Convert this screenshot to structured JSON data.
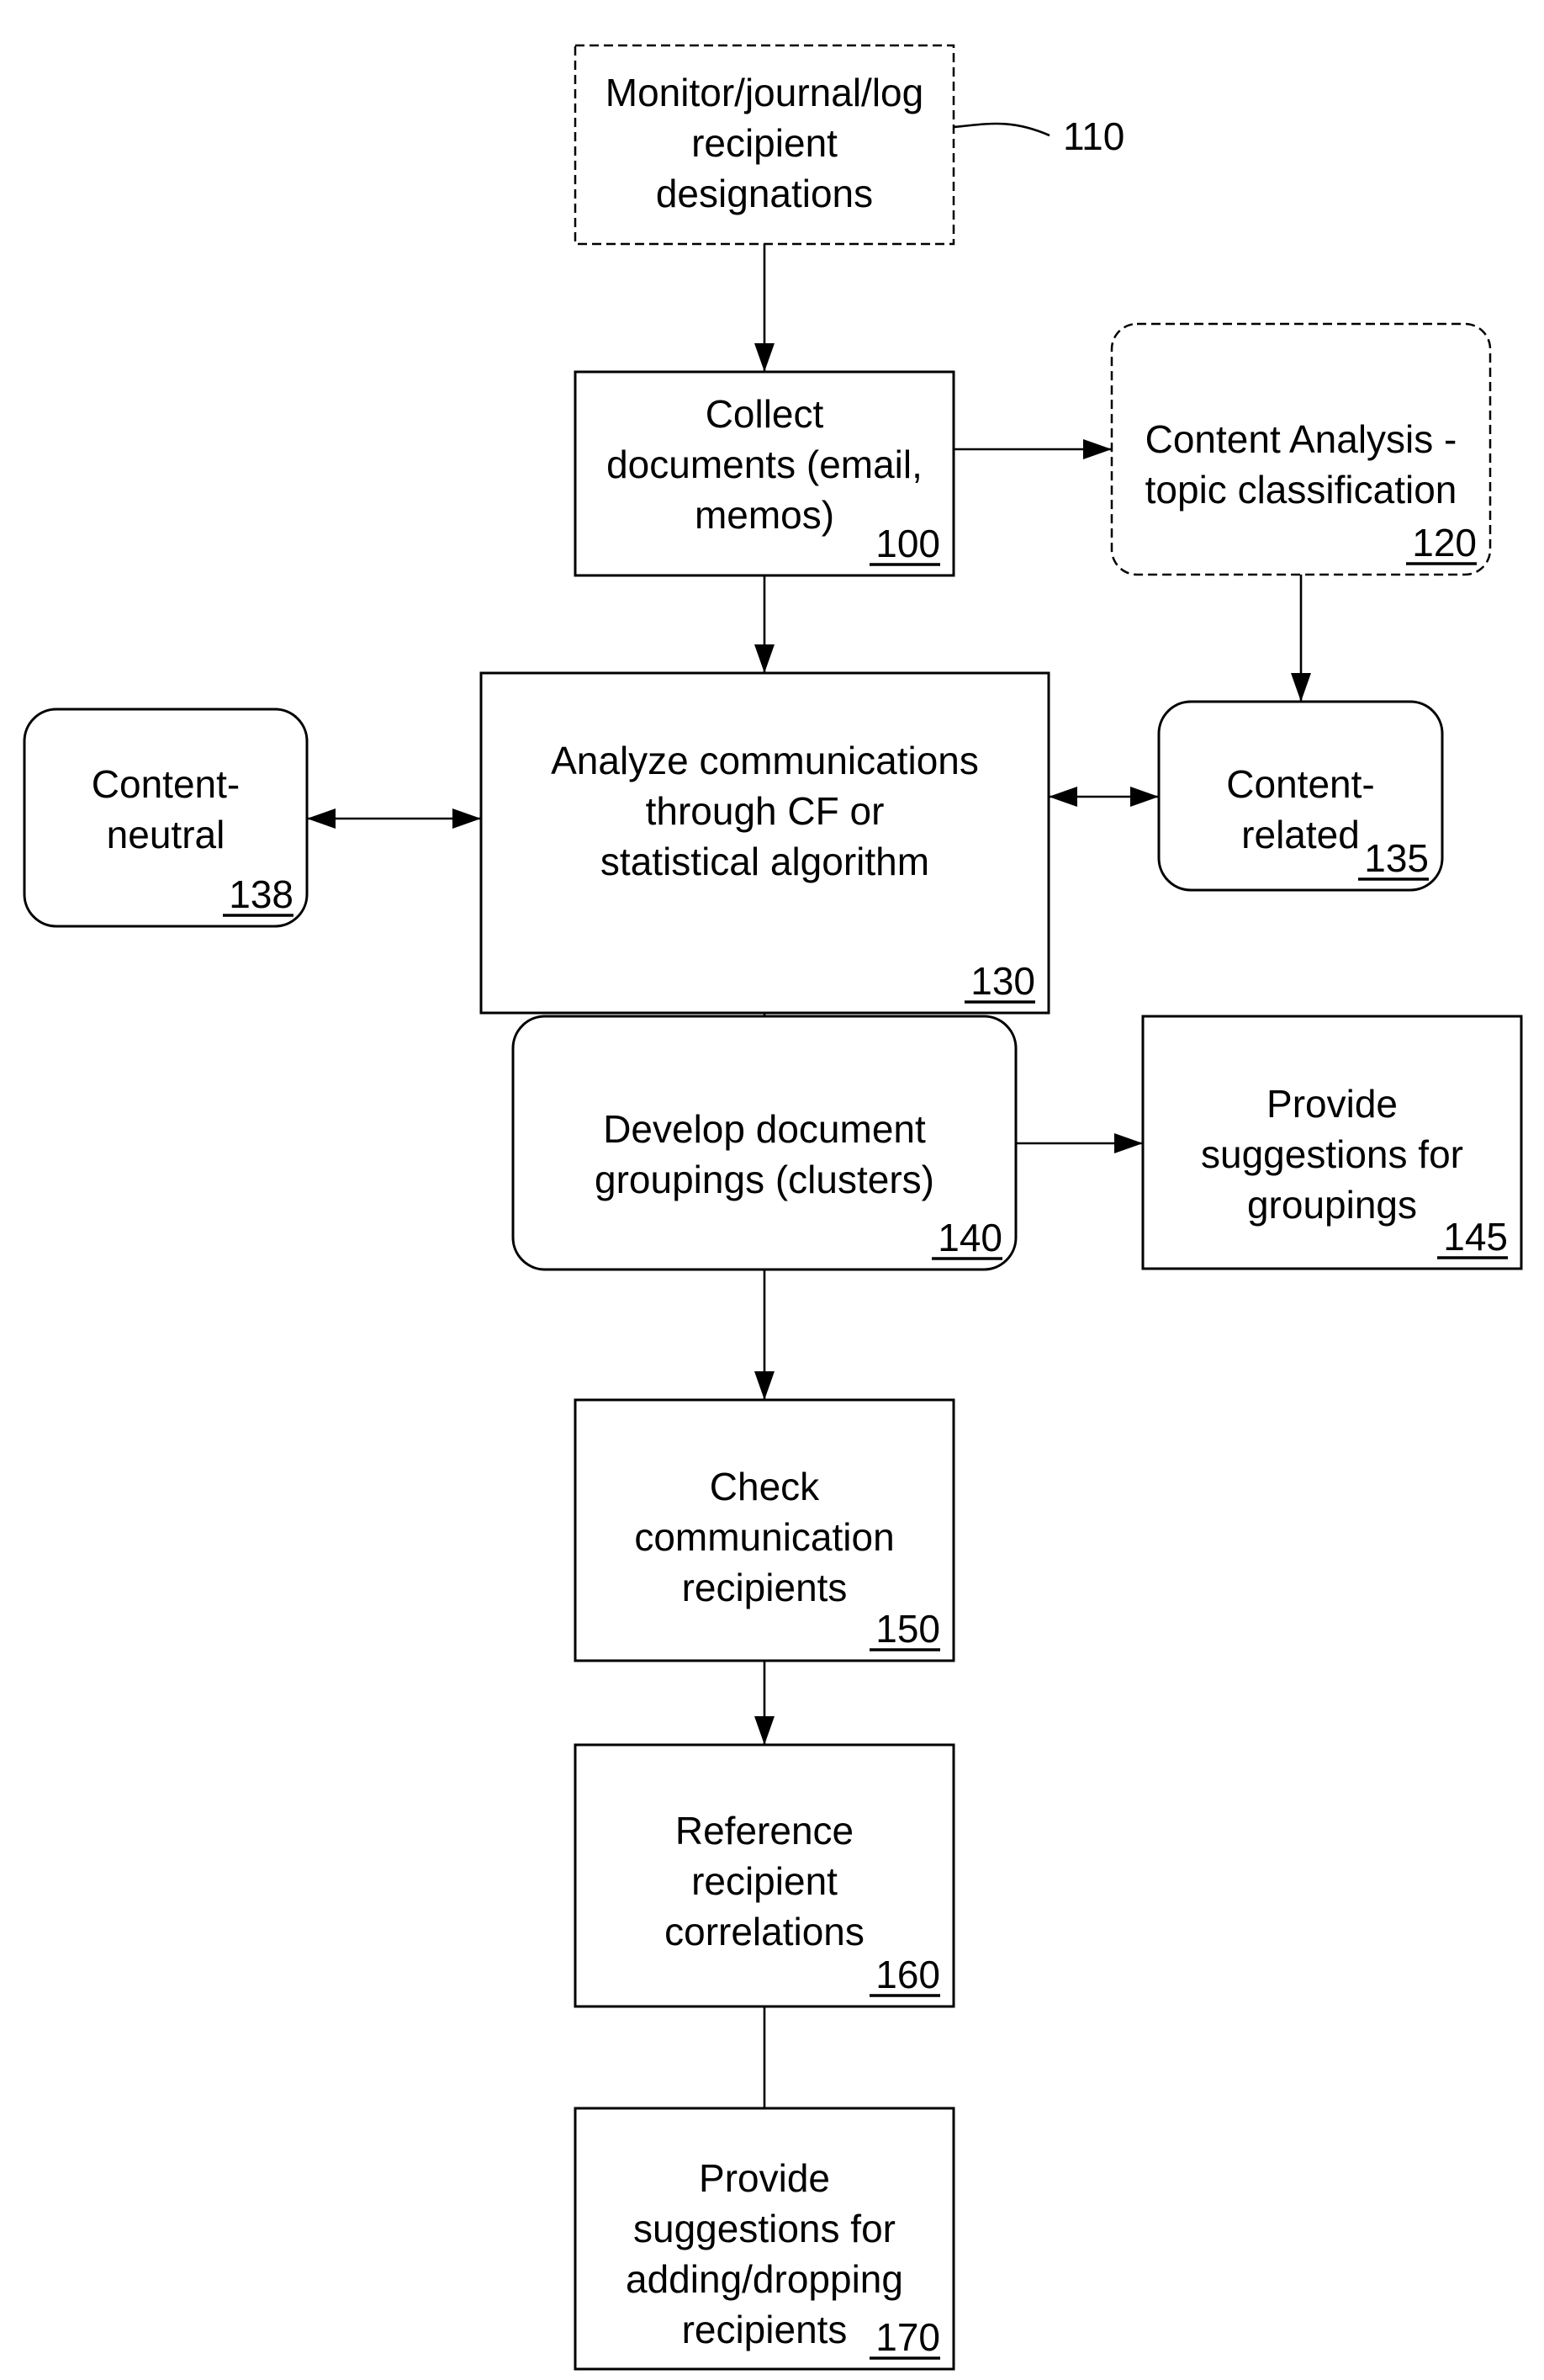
{
  "diagram": {
    "type": "flowchart",
    "nodes": [
      {
        "id": "110",
        "lines": [
          "Monitor/journal/log",
          "recipient",
          "designations"
        ],
        "ref": "",
        "callout": "110",
        "style": "dashed"
      },
      {
        "id": "100",
        "lines": [
          "Collect",
          "documents (email,",
          "memos)"
        ],
        "ref": "100",
        "style": "solid"
      },
      {
        "id": "120",
        "lines": [
          "Content Analysis -",
          "topic classification"
        ],
        "ref": "120",
        "style": "dashed-rounded"
      },
      {
        "id": "130",
        "lines": [
          "Analyze communications",
          "through CF or",
          "statistical algorithm"
        ],
        "ref": "130",
        "style": "solid"
      },
      {
        "id": "138",
        "lines": [
          "Content-",
          "neutral"
        ],
        "ref": "138",
        "style": "rounded"
      },
      {
        "id": "135",
        "lines": [
          "Content-",
          "related"
        ],
        "ref": "135",
        "style": "rounded"
      },
      {
        "id": "140",
        "lines": [
          "Develop document",
          "groupings (clusters)"
        ],
        "ref": "140",
        "style": "rounded"
      },
      {
        "id": "145",
        "lines": [
          "Provide",
          "suggestions for",
          "groupings"
        ],
        "ref": "145",
        "style": "solid"
      },
      {
        "id": "150",
        "lines": [
          "Check",
          "communication",
          "recipients"
        ],
        "ref": "150",
        "style": "solid"
      },
      {
        "id": "160",
        "lines": [
          "Reference",
          "recipient",
          "correlations"
        ],
        "ref": "160",
        "style": "solid"
      },
      {
        "id": "170",
        "lines": [
          "Provide",
          "suggestions for",
          "adding/dropping",
          "recipients"
        ],
        "ref": "170",
        "style": "solid"
      }
    ],
    "edges": [
      {
        "from": "110",
        "to": "100",
        "arrow": "end"
      },
      {
        "from": "100",
        "to": "120",
        "arrow": "end"
      },
      {
        "from": "100",
        "to": "130",
        "arrow": "end"
      },
      {
        "from": "120",
        "to": "135",
        "arrow": "end"
      },
      {
        "from": "130",
        "to": "138",
        "arrow": "both"
      },
      {
        "from": "130",
        "to": "135",
        "arrow": "both"
      },
      {
        "from": "130",
        "to": "140",
        "arrow": "end"
      },
      {
        "from": "140",
        "to": "145",
        "arrow": "end"
      },
      {
        "from": "140",
        "to": "150",
        "arrow": "end"
      },
      {
        "from": "150",
        "to": "160",
        "arrow": "end"
      },
      {
        "from": "160",
        "to": "170",
        "arrow": "none"
      }
    ]
  }
}
